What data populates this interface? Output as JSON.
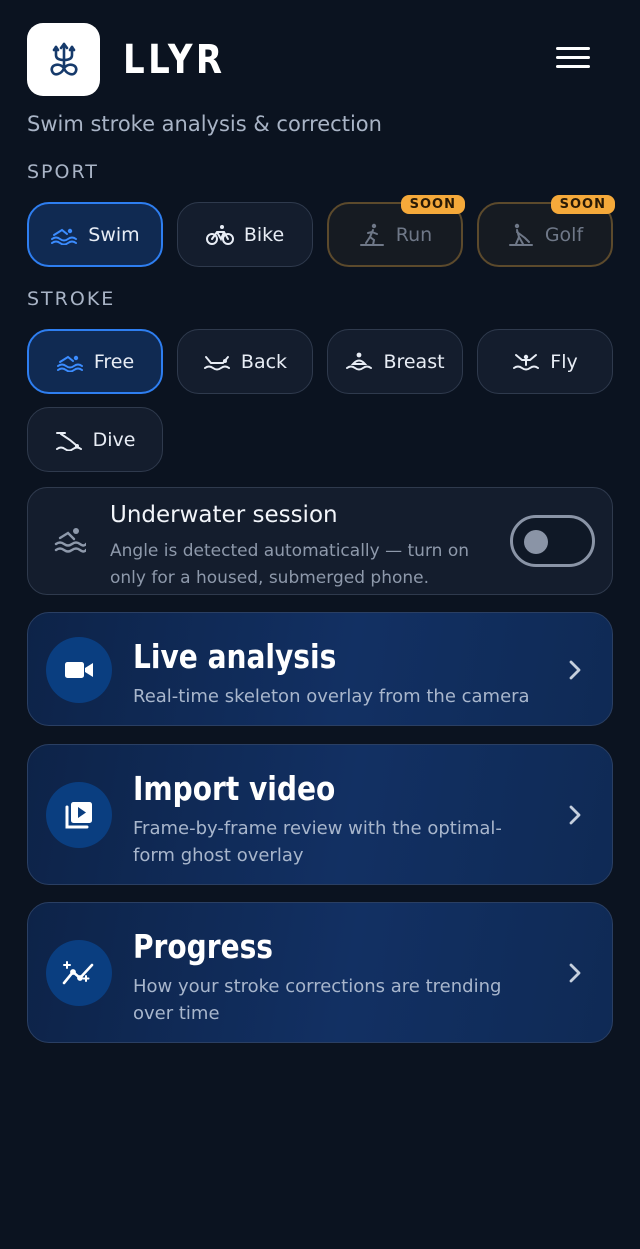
{
  "app": {
    "name": "LLYR",
    "tagline": "Swim stroke analysis & correction"
  },
  "sport": {
    "label": "SPORT",
    "items": [
      {
        "label": "Swim",
        "icon": "swim-icon",
        "state": "selected"
      },
      {
        "label": "Bike",
        "icon": "bike-icon",
        "state": "normal"
      },
      {
        "label": "Run",
        "icon": "run-icon",
        "state": "disabled",
        "badge": "SOON"
      },
      {
        "label": "Golf",
        "icon": "golf-icon",
        "state": "disabled",
        "badge": "SOON"
      }
    ]
  },
  "stroke": {
    "label": "STROKE",
    "items": [
      {
        "label": "Free",
        "icon": "freestyle-icon",
        "state": "selected"
      },
      {
        "label": "Back",
        "icon": "backstroke-icon",
        "state": "normal"
      },
      {
        "label": "Breast",
        "icon": "breaststroke-icon",
        "state": "normal"
      },
      {
        "label": "Fly",
        "icon": "butterfly-icon",
        "state": "normal"
      },
      {
        "label": "Dive",
        "icon": "dive-icon",
        "state": "normal"
      }
    ]
  },
  "underwater": {
    "title": "Underwater session",
    "description": "Angle is detected automatically — turn on only for a housed, submerged phone.",
    "enabled": false,
    "icon": "swimmer-wave-icon"
  },
  "actions": [
    {
      "title": "Live analysis",
      "description": "Real-time skeleton overlay from the camera",
      "icon": "video-camera-icon"
    },
    {
      "title": "Import video",
      "description": "Frame-by-frame review with the optimal-form ghost overlay",
      "icon": "video-library-icon"
    },
    {
      "title": "Progress",
      "description": "How your stroke corrections are trending over time",
      "icon": "trend-sparkle-icon"
    }
  ],
  "colors": {
    "background": "#0b1320",
    "accent": "#2e7ef0",
    "badge": "#f5a93a"
  }
}
